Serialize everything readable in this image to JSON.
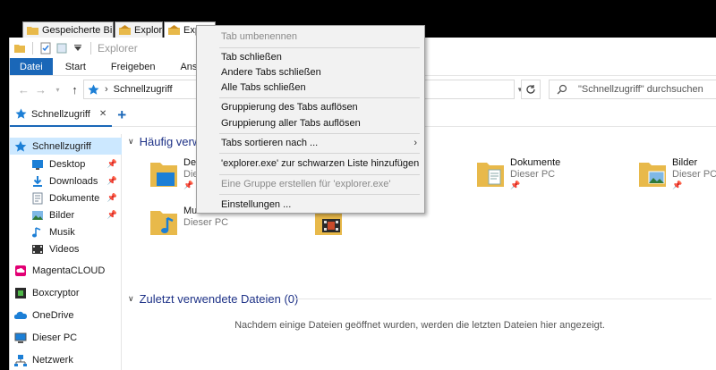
{
  "browser_tabs": [
    {
      "label": "Gespeicherte Bilder",
      "icon": "folder-icon"
    },
    {
      "label": "Explorer",
      "icon": "home-folder-icon"
    },
    {
      "label": "Explorer",
      "icon": "home-folder-icon"
    }
  ],
  "window": {
    "title": "Explorer",
    "ribbon_tabs": [
      "Datei",
      "Start",
      "Freigeben",
      "Ansicht"
    ],
    "address": {
      "path": "Schnellzugriff",
      "separator": "›"
    },
    "search_placeholder": "\"Schnellzugriff\" durchsuchen",
    "inner_tab": {
      "label": "Schnellzugriff",
      "close": "✕",
      "add": "+"
    }
  },
  "sidebar": {
    "items": [
      {
        "label": "Schnellzugriff",
        "icon": "star-icon",
        "pinned": false,
        "selected": true
      },
      {
        "label": "Desktop",
        "icon": "desktop-icon",
        "pinned": true
      },
      {
        "label": "Downloads",
        "icon": "download-icon",
        "pinned": true
      },
      {
        "label": "Dokumente",
        "icon": "documents-icon",
        "pinned": true
      },
      {
        "label": "Bilder",
        "icon": "pictures-icon",
        "pinned": true
      },
      {
        "label": "Musik",
        "icon": "music-icon",
        "pinned": false
      },
      {
        "label": "Videos",
        "icon": "videos-icon",
        "pinned": false
      },
      {
        "label": "MagentaCLOUD",
        "icon": "magentacloud-icon",
        "pinned": false
      },
      {
        "label": "Boxcryptor",
        "icon": "boxcryptor-icon",
        "pinned": false
      },
      {
        "label": "OneDrive",
        "icon": "onedrive-icon",
        "pinned": false
      },
      {
        "label": "Dieser PC",
        "icon": "pc-icon",
        "pinned": false
      },
      {
        "label": "Netzwerk",
        "icon": "network-icon",
        "pinned": false
      }
    ]
  },
  "main": {
    "frequent_header": "Häufig verwe",
    "recent_header": "Zuletzt verwendete Dateien (0)",
    "empty_message": "Nachdem einige Dateien geöffnet wurden, werden die letzten Dateien hier angezeigt.",
    "tiles": [
      {
        "name": "Des",
        "sub": "Dieser",
        "pinned": true
      },
      {
        "name": "Dokumente",
        "sub": "Dieser PC",
        "pinned": true
      },
      {
        "name": "Bilder",
        "sub": "Dieser PC",
        "pinned": true
      },
      {
        "name": "Mu",
        "sub": "Dieser PC",
        "pinned": false
      },
      {
        "name": "",
        "sub": "Dieser PC",
        "pinned": false
      }
    ]
  },
  "context_menu": {
    "items": [
      {
        "label": "Tab umbenennen",
        "disabled": true
      },
      {
        "label": "Tab schließen",
        "disabled": false
      },
      {
        "label": "Andere Tabs schließen",
        "disabled": false
      },
      {
        "label": "Alle Tabs schließen",
        "disabled": false
      },
      {
        "label": "Gruppierung des Tabs auflösen",
        "disabled": false
      },
      {
        "label": "Gruppierung aller Tabs auflösen",
        "disabled": false
      },
      {
        "label": "Tabs sortieren nach ...",
        "disabled": false,
        "submenu_arrow": "›"
      },
      {
        "label": "'explorer.exe' zur schwarzen Liste hinzufügen",
        "disabled": false
      },
      {
        "label": "Eine Gruppe erstellen für 'explorer.exe'",
        "disabled": true
      },
      {
        "label": "Einstellungen ...",
        "disabled": false
      }
    ]
  },
  "colors": {
    "accent": "#1a67b8",
    "folder": "#e8b94a",
    "selected_bg": "#cce8ff",
    "header_text": "#1e3287",
    "menu_bg": "#f2f2f2"
  }
}
